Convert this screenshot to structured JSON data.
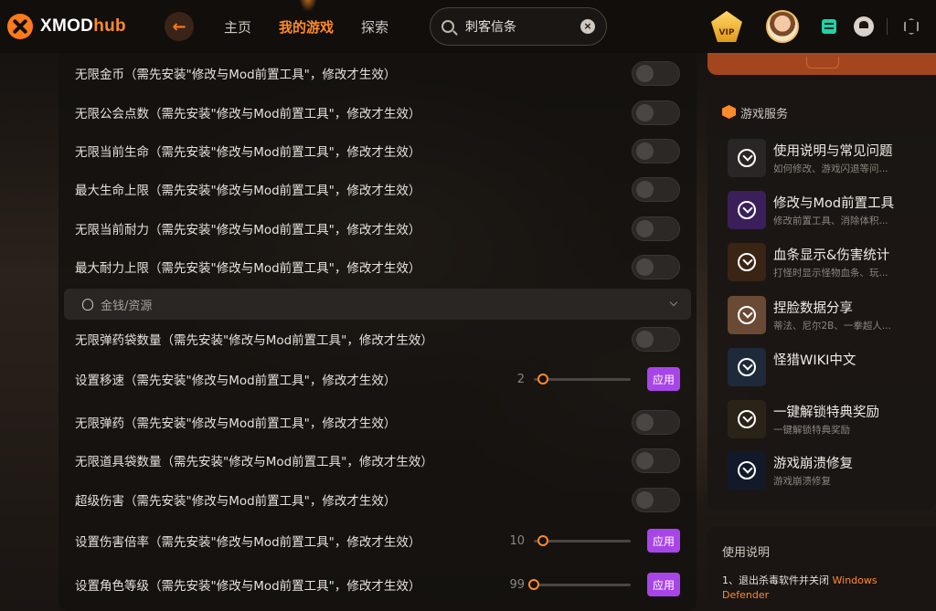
{
  "app": {
    "logo_main": "XMOD",
    "logo_accent": "hub"
  },
  "nav": {
    "home": "主页",
    "my_games": "我的游戏",
    "explore": "探索"
  },
  "search": {
    "value": "刺客信条",
    "clear": "×"
  },
  "vip": {
    "label": "VIP"
  },
  "settings": [
    {
      "label": "无限金币（需先安装\"修改与Mod前置工具\"，修改才生效）",
      "control": "toggle"
    },
    {
      "label": "无限公会点数（需先安装\"修改与Mod前置工具\"，修改才生效）",
      "control": "toggle"
    },
    {
      "label": "无限当前生命（需先安装\"修改与Mod前置工具\"，修改才生效）",
      "control": "toggle"
    },
    {
      "label": "最大生命上限（需先安装\"修改与Mod前置工具\"，修改才生效）",
      "control": "toggle"
    },
    {
      "label": "无限当前耐力（需先安装\"修改与Mod前置工具\"，修改才生效）",
      "control": "toggle"
    },
    {
      "label": "最大耐力上限（需先安装\"修改与Mod前置工具\"，修改才生效）",
      "control": "toggle"
    }
  ],
  "section": {
    "label": "金钱/资源"
  },
  "settings2": [
    {
      "label": "无限弹药袋数量（需先安装\"修改与Mod前置工具\"，修改才生效）",
      "control": "toggle"
    },
    {
      "label": "设置移速（需先安装\"修改与Mod前置工具\"，修改才生效）",
      "control": "slider",
      "value": "2",
      "apply": "应用"
    },
    {
      "label": "无限弹药（需先安装\"修改与Mod前置工具\"，修改才生效）",
      "control": "toggle"
    },
    {
      "label": "无限道具袋数量（需先安装\"修改与Mod前置工具\"，修改才生效）",
      "control": "toggle"
    },
    {
      "label": "超级伤害（需先安装\"修改与Mod前置工具\"，修改才生效）",
      "control": "toggle"
    },
    {
      "label": "设置伤害倍率（需先安装\"修改与Mod前置工具\"，修改才生效）",
      "control": "slider",
      "value": "10",
      "apply": "应用"
    },
    {
      "label": "设置角色等级（需先安装\"修改与Mod前置工具\"，修改才生效）",
      "control": "slider",
      "value": "99",
      "apply": "应用"
    }
  ],
  "services": {
    "title": "游戏服务",
    "items": [
      {
        "title": "使用说明与常见问题",
        "sub": "如何修改、游戏闪退等问...",
        "color": "#2a2626"
      },
      {
        "title": "修改与Mod前置工具",
        "sub": "修改前置工具、消除体积...",
        "color": "#3a1f5a"
      },
      {
        "title": "血条显示&伤害统计",
        "sub": "打怪时显示怪物血条、玩...",
        "color": "#3a2414"
      },
      {
        "title": "捏脸数据分享",
        "sub": "蒂法、尼尔2B、一拳超人...",
        "color": "#6a4a34"
      },
      {
        "title": "怪猎WIKI中文",
        "sub": "",
        "color": "#1e2a3a"
      },
      {
        "title": "一键解锁特典奖励",
        "sub": "一键解锁特典奖励",
        "color": "#2a2418"
      },
      {
        "title": "游戏崩溃修复",
        "sub": "游戏崩溃修复",
        "color": "#121a2a"
      }
    ]
  },
  "usage": {
    "title": "使用说明",
    "text_prefix": "1、退出杀毒软件并关闭 ",
    "text_highlight": "Windows Defender"
  }
}
